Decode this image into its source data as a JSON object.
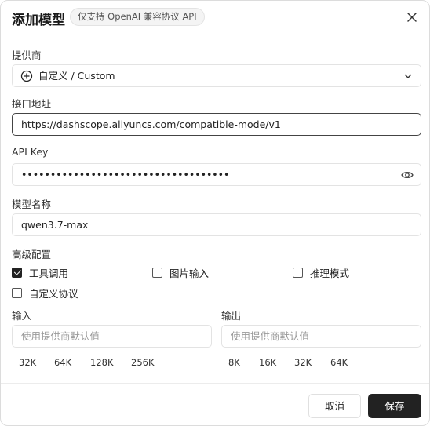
{
  "dialog": {
    "title": "添加模型",
    "badge": "仅支持 OpenAI 兼容协议 API"
  },
  "provider": {
    "label": "提供商",
    "selected": "自定义 / Custom"
  },
  "endpoint": {
    "label": "接口地址",
    "value": "https://dashscope.aliyuncs.com/compatible-mode/v1"
  },
  "api_key": {
    "label": "API Key",
    "masked_value": "••••••••••••••••••••••••••••••••••••"
  },
  "model_name": {
    "label": "模型名称",
    "value": "qwen3.7-max"
  },
  "advanced": {
    "label": "高级配置",
    "options": [
      {
        "label": "工具调用",
        "checked": true
      },
      {
        "label": "图片输入",
        "checked": false
      },
      {
        "label": "推理模式",
        "checked": false
      },
      {
        "label": "自定义协议",
        "checked": false
      }
    ]
  },
  "input_ctx": {
    "label": "输入",
    "placeholder": "使用提供商默认值",
    "presets": [
      "32K",
      "64K",
      "128K",
      "256K"
    ]
  },
  "output_ctx": {
    "label": "输出",
    "placeholder": "使用提供商默认值",
    "presets": [
      "8K",
      "16K",
      "32K",
      "64K"
    ]
  },
  "footer": {
    "cancel_label": "取消",
    "save_label": "保存"
  },
  "colors": {
    "primary_button": "#222222",
    "border": "#e3e3e3"
  }
}
